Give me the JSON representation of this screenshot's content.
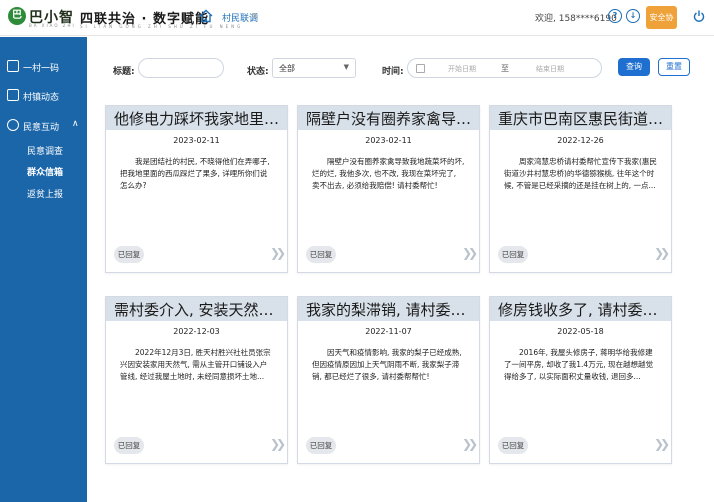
{
  "header": {
    "logo_char": "巴",
    "brand": "巴小智",
    "brand_sub": "BA XIAO ZHI",
    "slogan": "四联共治 · 数字赋能",
    "slogan_sub": "SI LIAN GONG ZHI SHU ZI FU NENG",
    "active_tab": "村民联调",
    "tab_close": "x",
    "welcome": "欢迎, 158****6190",
    "help_icon_glyph": "?",
    "download_icon_glyph": "↓",
    "agreement_label": "安全协议"
  },
  "sidebar": {
    "items": [
      {
        "label": "一村一码"
      },
      {
        "label": "村镇动态"
      },
      {
        "label": "民意互动",
        "chevron": "∧"
      }
    ],
    "subitems": [
      {
        "label": "民意调查"
      },
      {
        "label": "群众信箱"
      },
      {
        "label": "返贫上报"
      }
    ]
  },
  "filters": {
    "title_label": "标题:",
    "title_value": "",
    "status_label": "状态:",
    "status_value": "全部",
    "time_label": "时间:",
    "start_placeholder": "开始日期",
    "date_sep": "至",
    "end_placeholder": "结束日期",
    "query_label": "查询",
    "reset_label": "重置"
  },
  "cards": [
    {
      "title": "他修电力踩坏我家地里的西瓜",
      "date": "2023-02-11",
      "body": "我是团结社的村民, 不晓得他们在弄哪子, 把我地里面的西瓜踩烂了果多, 详哩所你们说怎么办?",
      "status": "已回复"
    },
    {
      "title": "隔壁户没有圈养家禽导致我家菜",
      "date": "2023-02-11",
      "body": "隔壁户没有圈养家禽导致我地蔬菜坏的坏, 烂的烂, 我他多次, 也不改, 我现在菜坏完了, 卖不出去, 必须给我赔偿! 请村委帮忙!",
      "status": "已回复"
    },
    {
      "title": "重庆市巴南区惠民街道周家湾慧",
      "date": "2022-12-26",
      "body": "周家湾慧忠桥请村委帮忙宣传下我家(惠民街道沙井村慧忠桥)的华德猕猴桃, 往年这个时候, 不管是已经采摘的还是挂在树上的, 一点...",
      "status": "已回复"
    },
    {
      "title": "需村委介入, 安装天然气管道",
      "date": "2022-12-03",
      "body": "2022年12月3日, 胜天村胜兴社社员张宗兴因安装家用天然气, 需从主管开口铺设入户管线, 经过我屋土地时, 未经同意损坏土地...",
      "status": "已回复"
    },
    {
      "title": "我家的梨滞销, 请村委帮帮我",
      "date": "2022-11-07",
      "body": "因天气和疫情影响, 我家的梨子已经成熟, 但因疫情原因加上天气阴雨不断, 我家梨子滞销, 都已经烂了很多, 请村委帮帮忙!",
      "status": "已回复"
    },
    {
      "title": "修房钱收多了, 请村委出面协调",
      "date": "2022-05-18",
      "body": "2016年, 我屋头修房子, 蒋明华给我修建了一间平房, 却收了我1.4万元, 现在越想越觉得给多了, 以实际面积丈量收钱, 退回多...",
      "status": "已回复"
    }
  ],
  "icons": {
    "home": "home-icon",
    "power": "power-icon",
    "calendar": "calendar-icon",
    "arrow": "double-chevron-right-icon"
  },
  "colors": {
    "sidebar": "#1b66a9",
    "accent": "#1e6fd0",
    "agree": "#f0a23a",
    "card_head": "#d8e1ea"
  }
}
